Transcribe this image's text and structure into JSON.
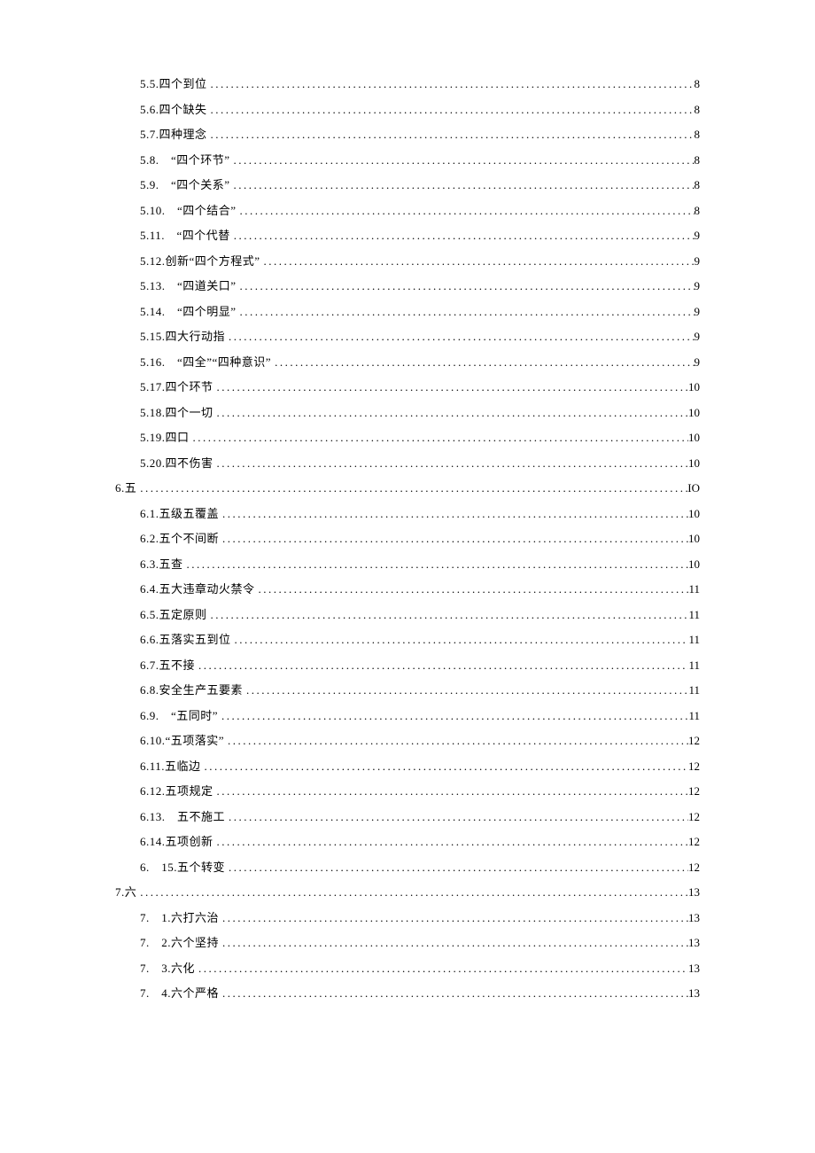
{
  "toc": [
    {
      "indent": 1,
      "label": "5.5.四个到位",
      "page": "8"
    },
    {
      "indent": 1,
      "label": "5.6.四个缺失",
      "page": "8"
    },
    {
      "indent": 1,
      "label": "5.7.四种理念",
      "page": "8"
    },
    {
      "indent": 1,
      "label": "5.8.　“四个环节”",
      "page": "8"
    },
    {
      "indent": 1,
      "label": "5.9.　“四个关系”",
      "page": "8"
    },
    {
      "indent": 1,
      "label": "5.10.　“四个结合”",
      "page": "8"
    },
    {
      "indent": 1,
      "label": "5.11.　“四个代替",
      "page": "9"
    },
    {
      "indent": 1,
      "label": "5.12.创新“四个方程式”",
      "page": "9"
    },
    {
      "indent": 1,
      "label": "5.13.　“四道关口”",
      "page": "9"
    },
    {
      "indent": 1,
      "label": "5.14.　“四个明显”",
      "page": "9"
    },
    {
      "indent": 1,
      "label": "5.15.四大行动指",
      "page": "9"
    },
    {
      "indent": 1,
      "label": "5.16.　“四全”“四种意识”",
      "page": "9"
    },
    {
      "indent": 1,
      "label": "5.17.四个环节",
      "page": "10"
    },
    {
      "indent": 1,
      "label": "5.18.四个一切",
      "page": "10"
    },
    {
      "indent": 1,
      "label": "5.19.四口",
      "page": "10"
    },
    {
      "indent": 1,
      "label": "5.20.四不伤害",
      "page": "10"
    },
    {
      "indent": 0,
      "label": "6.五",
      "page": "IO"
    },
    {
      "indent": 1,
      "label": "6.1.五级五覆盖",
      "page": "10"
    },
    {
      "indent": 1,
      "label": "6.2.五个不间断",
      "page": "10"
    },
    {
      "indent": 1,
      "label": "6.3.五查",
      "page": "10"
    },
    {
      "indent": 1,
      "label": "6.4.五大违章动火禁令",
      "page": "11"
    },
    {
      "indent": 1,
      "label": "6.5.五定原则",
      "page": "11"
    },
    {
      "indent": 1,
      "label": "6.6.五落实五到位",
      "page": "11"
    },
    {
      "indent": 1,
      "label": "6.7.五不接",
      "page": "11"
    },
    {
      "indent": 1,
      "label": "6.8.安全生产五要素",
      "page": "11"
    },
    {
      "indent": 1,
      "label": "6.9.　“五同时”",
      "page": "11"
    },
    {
      "indent": 1,
      "label": "6.10.“五项落实”",
      "page": "12"
    },
    {
      "indent": 1,
      "label": "6.11.五临边",
      "page": "12"
    },
    {
      "indent": 1,
      "label": "6.12.五项规定",
      "page": "12"
    },
    {
      "indent": 1,
      "label": "6.13.　五不施工",
      "page": "12"
    },
    {
      "indent": 1,
      "label": "6.14.五项创新",
      "page": "12"
    },
    {
      "indent": 1,
      "label": "6.　15.五个转变",
      "page": "12"
    },
    {
      "indent": 0,
      "label": "7.六",
      "page": "13"
    },
    {
      "indent": 1,
      "label": "7.　1.六打六治",
      "page": "13"
    },
    {
      "indent": 1,
      "label": "7.　2.六个坚持",
      "page": "13"
    },
    {
      "indent": 1,
      "label": "7.　3.六化",
      "page": "13"
    },
    {
      "indent": 1,
      "label": "7.　4.六个严格",
      "page": "13"
    }
  ]
}
